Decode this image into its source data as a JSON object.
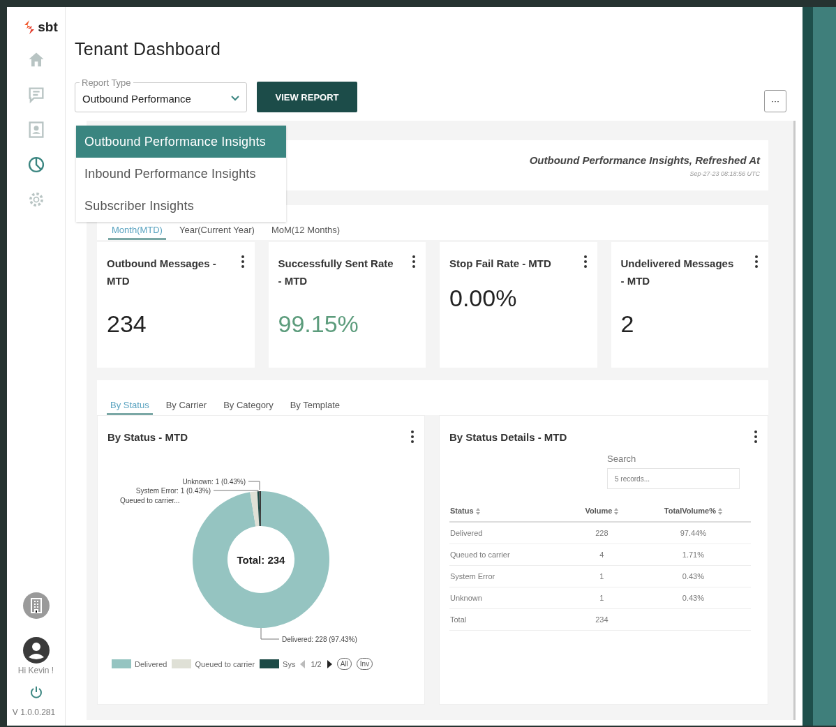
{
  "sidebar": {
    "logo": "sbt",
    "items": [
      {
        "kind": "home",
        "selected": false
      },
      {
        "kind": "chat",
        "selected": false
      },
      {
        "kind": "contacts",
        "selected": false
      },
      {
        "kind": "reports",
        "selected": true
      },
      {
        "kind": "settings",
        "selected": false
      }
    ],
    "greeting": "Hi Kevin !",
    "version": "V 1.0.0.281"
  },
  "title": "Tenant Dashboard",
  "report_type": {
    "label": "Report Type",
    "value": "Outbound Performance",
    "expanded": true,
    "options": [
      {
        "label": "Outbound Performance Insights",
        "selected": true
      },
      {
        "label": "Inbound Performance Insights",
        "selected": false
      },
      {
        "label": "Subscriber Insights",
        "selected": false
      }
    ]
  },
  "view_button": "VIEW REPORT",
  "more_button": "···",
  "refresh": {
    "title": "Outbound Performance Insights, Refreshed At",
    "timestamp": "Sep-27-23 08:18:56 UTC"
  },
  "period_tabs": [
    {
      "label": "Month(MTD)",
      "selected": true
    },
    {
      "label": "Year(Current Year)",
      "selected": false
    },
    {
      "label": "MoM(12 Months)",
      "selected": false
    }
  ],
  "kpis": [
    {
      "title": "Outbound Messages - MTD",
      "value": "234",
      "color": "#222222"
    },
    {
      "title": "Successfully Sent Rate - MTD",
      "value": "99.15%",
      "color": "#5c9c7c"
    },
    {
      "title": "Stop Fail Rate - MTD",
      "value": "0.00%",
      "color": "#222222"
    },
    {
      "title": "Undelivered Messages - MTD",
      "value": "2",
      "color": "#222222"
    }
  ],
  "breakdown_tabs": [
    {
      "label": "By Status",
      "selected": true
    },
    {
      "label": "By Carrier",
      "selected": false
    },
    {
      "label": "By Category",
      "selected": false
    },
    {
      "label": "By Template",
      "selected": false
    }
  ],
  "status_chart": {
    "title": "By Status - MTD",
    "center_label": "Total: 234",
    "chart_data": {
      "type": "donut",
      "series": [
        {
          "values": [
            97.43,
            1.71,
            0.43,
            0.43
          ]
        }
      ],
      "colors": [
        "#95c4c1",
        "#dfe0d6",
        "#1d4b47",
        "#3a3a3a"
      ],
      "annotations": [
        "Unknown: 1 (0.43%)",
        "System Error: 1 (0.43%)",
        "Queued to carrier...",
        "Delivered: 228 (97.43%)"
      ]
    },
    "legend": {
      "items": [
        {
          "label": "Delivered",
          "color": "#95c4c1"
        },
        {
          "label": "Queued to carrier",
          "color": "#dfe0d6"
        },
        {
          "label": "Sys",
          "color": "#1d4b47"
        }
      ],
      "page": "1/2",
      "buttons": [
        "All",
        "Inv"
      ]
    }
  },
  "status_table": {
    "title": "By Status Details - MTD",
    "search_label": "Search",
    "search_placeholder": "5 records...",
    "columns": [
      "Status",
      "Volume",
      "TotalVolume%"
    ],
    "rows": [
      [
        "Delivered",
        "228",
        "97.44%"
      ],
      [
        "Queued to carrier",
        "4",
        "1.71%"
      ],
      [
        "System Error",
        "1",
        "0.43%"
      ],
      [
        "Unknown",
        "1",
        "0.43%"
      ],
      [
        "Total",
        "234"
      ]
    ]
  }
}
